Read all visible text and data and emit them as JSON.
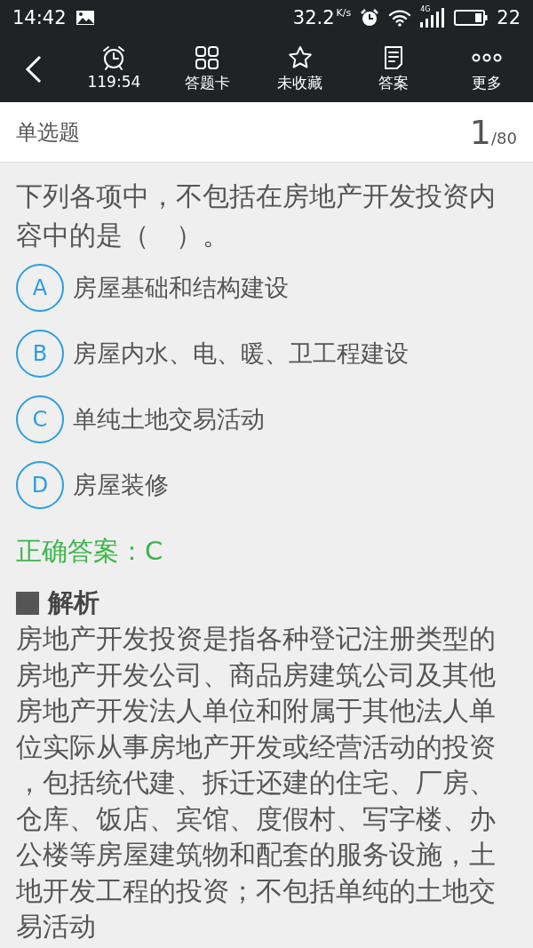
{
  "status_bar": {
    "time": "14:42",
    "speed": "32.2",
    "speed_unit": "K/s",
    "network": "4G",
    "battery": "22"
  },
  "toolbar": {
    "items": [
      {
        "kind": "alarm",
        "label": "119:54"
      },
      {
        "kind": "grid",
        "label": "答题卡"
      },
      {
        "kind": "star",
        "label": "未收藏"
      },
      {
        "kind": "document",
        "label": "答案"
      },
      {
        "kind": "more",
        "label": "更多"
      }
    ]
  },
  "question": {
    "type": "单选题",
    "number": "1",
    "total": "/80",
    "text": "下列各项中，不包括在房地产开发投资内容中的是（　）。",
    "options": [
      {
        "letter": "A",
        "text": "房屋基础和结构建设",
        "selected": false
      },
      {
        "letter": "B",
        "text": "房屋内水、电、暖、卫工程建设",
        "selected": false
      },
      {
        "letter": "C",
        "text": "单纯土地交易活动",
        "selected": false
      },
      {
        "letter": "D",
        "text": "房屋装修",
        "selected": false
      }
    ],
    "answer": "正确答案：C",
    "analysis_title": "解析",
    "analysis": "房地产开发投资是指各种登记注册类型的房地产开发公司、商品房建筑公司及其他房地产开发法人单位和附属于其他法人单位实际从事房地产开发或经营活动的投资，包括统代建、拆迁还建的住宅、厂房、仓库、饭店、宾馆、度假村、写字楼、办公楼等房屋建筑物和配套的服务设施，土地开发工程的投资；不包括单纯的土地交易活动"
  }
}
